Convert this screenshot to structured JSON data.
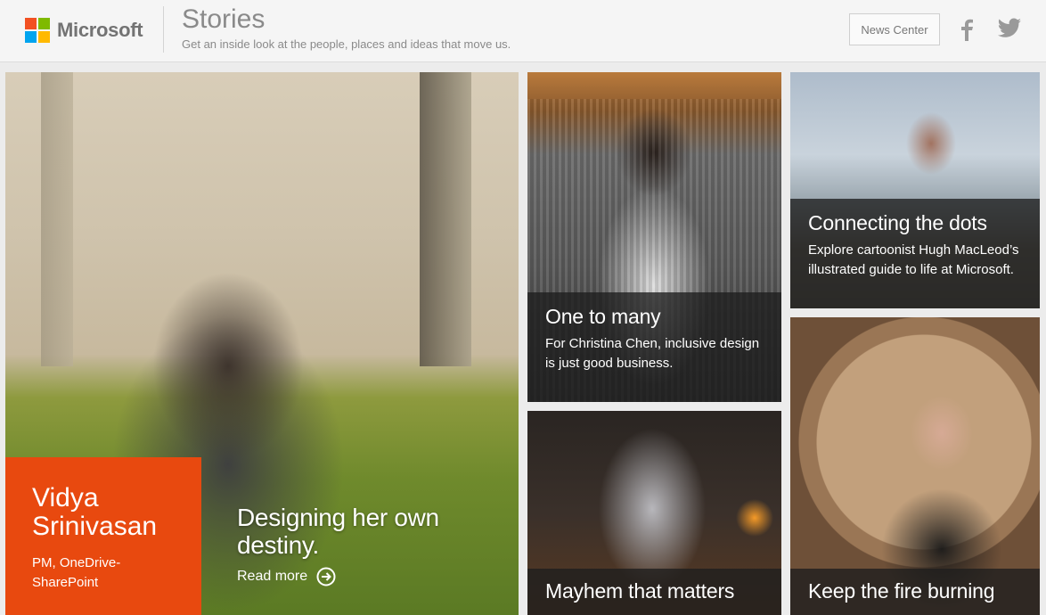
{
  "header": {
    "brand": "Microsoft",
    "section_title": "Stories",
    "tagline": "Get an inside look at the people, places and ideas that move us.",
    "news_button": "News Center",
    "social": [
      "facebook-icon",
      "twitter-icon"
    ],
    "logo_colors": [
      "#f25022",
      "#7fba00",
      "#00a4ef",
      "#ffb900"
    ]
  },
  "hero": {
    "person_name": "Vidya Srinivasan",
    "person_role": "PM, OneDrive-SharePoint",
    "headline": "Designing her own destiny.",
    "read_more": "Read more",
    "accent_color": "#e8490f"
  },
  "tiles": [
    {
      "title": "One to many",
      "description": "For Christina Chen, inclusive design is just good business."
    },
    {
      "title": "Connecting the dots",
      "description": "Explore cartoonist Hugh MacLeod’s illustrated guide to life at Microsoft."
    },
    {
      "title": "Mayhem that matters",
      "description": ""
    },
    {
      "title": "Keep the fire burning",
      "description": ""
    }
  ]
}
